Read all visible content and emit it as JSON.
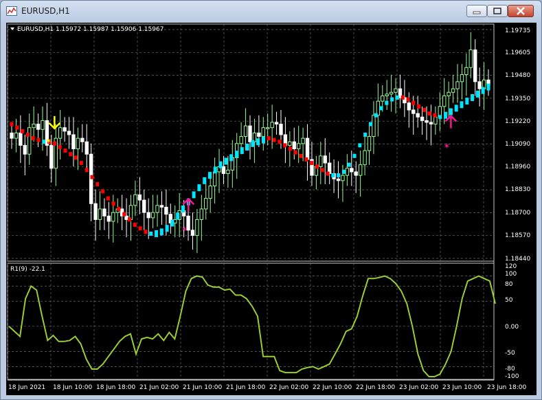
{
  "window": {
    "title": "EURUSD,H1"
  },
  "colors": {
    "background": "#000000",
    "grid": "#6e6e6e",
    "bull_candle": "#98fb98",
    "bear_candle": "#ffffff",
    "trend_down": "#ff0000",
    "trend_up": "#00e5ff",
    "sell_arrow": "#ffff00",
    "buy_arrow": "#ff1493",
    "oscillator": "#9acd32",
    "text": "#ffffff"
  },
  "icons": {
    "app": "chart-window-icon",
    "minimize": "minimize-icon",
    "maximize": "maximize-icon",
    "close": "close-icon",
    "menu": "triangle-down-icon"
  },
  "main_panel": {
    "header": "EURUSD,H1  1.15972 1.15987 1.15906 1.15967",
    "price_labels": [
      "1.19735",
      "1.19605",
      "1.19480",
      "1.19350",
      "1.19220",
      "1.19090",
      "1.18960",
      "1.18830",
      "1.18700",
      "1.18570",
      "1.18440"
    ]
  },
  "sub_panel": {
    "header": "R1(9) -22.1",
    "level_labels": [
      "120",
      "100",
      "80",
      "50",
      "0.00",
      "-50",
      "-80",
      "-100"
    ]
  },
  "time_labels": [
    "18 Jun 2021",
    "18 Jun 10:00",
    "18 Jun 18:00",
    "21 Jun 02:00",
    "21 Jun 10:00",
    "21 Jun 18:00",
    "22 Jun 02:00",
    "22 Jun 10:00",
    "22 Jun 18:00",
    "23 Jun 02:00",
    "23 Jun 10:00",
    "23 Jun 18:00"
  ],
  "chart_data": {
    "type": "line",
    "symbol": "EURUSD",
    "timeframe": "H1",
    "ohlc_last": {
      "open": 1.15972,
      "high": 1.15987,
      "low": 1.15906,
      "close": 1.15967
    },
    "price_axis": [
      1.1844,
      1.19735
    ],
    "close_series": [
      1.1912,
      1.1915,
      1.1908,
      1.1903,
      1.1918,
      1.192,
      1.1917,
      1.1922,
      1.1908,
      1.1895,
      1.1912,
      1.1918,
      1.1916,
      1.1914,
      1.1906,
      1.1912,
      1.191,
      1.1903,
      1.1875,
      1.1866,
      1.1872,
      1.1868,
      1.1865,
      1.187,
      1.1872,
      1.1868,
      1.1866,
      1.1874,
      1.188,
      1.1877,
      1.187,
      1.1867,
      1.187,
      1.1874,
      1.1873,
      1.1869,
      1.1864,
      1.1866,
      1.1871,
      1.1868,
      1.186,
      1.1857,
      1.1866,
      1.1872,
      1.1878,
      1.1885,
      1.1893,
      1.1896,
      1.1892,
      1.1894,
      1.1901,
      1.1909,
      1.1913,
      1.1919,
      1.191,
      1.1915,
      1.1913,
      1.1918,
      1.1918,
      1.1921,
      1.192,
      1.1914,
      1.1908,
      1.191,
      1.1906,
      1.1909,
      1.1912,
      1.19,
      1.1891,
      1.1896,
      1.1902,
      1.1898,
      1.1892,
      1.1889,
      1.1888,
      1.1891,
      1.1895,
      1.1893,
      1.1891,
      1.1897,
      1.1905,
      1.1913,
      1.1925,
      1.1933,
      1.1936,
      1.1937,
      1.1938,
      1.194,
      1.1935,
      1.1932,
      1.1928,
      1.1926,
      1.1924,
      1.1922,
      1.1921,
      1.192,
      1.1924,
      1.193,
      1.1936,
      1.1938,
      1.194,
      1.1944,
      1.1948,
      1.1952,
      1.1962,
      1.1944,
      1.194,
      1.1945,
      1.1942
    ],
    "trend_line": [
      1.192,
      1.1918,
      1.1916,
      1.1914,
      1.1912,
      1.1911,
      1.191,
      1.191,
      1.1909,
      1.1907,
      1.1905,
      1.1903,
      1.1901,
      1.1898,
      1.1894,
      1.189,
      1.1886,
      1.1882,
      1.1878,
      1.1875,
      1.1872,
      1.1869,
      1.1866,
      1.1863,
      1.1861,
      1.1859,
      1.1858,
      1.1858,
      1.1859,
      1.1861,
      1.1864,
      1.1868,
      1.1872,
      1.1876,
      1.188,
      1.1884,
      1.1888,
      1.1891,
      1.1894,
      1.1897,
      1.1899,
      1.1901,
      1.1903,
      1.1905,
      1.1907,
      1.1909,
      1.191,
      1.1911,
      1.1912,
      1.1911,
      1.191,
      1.1908,
      1.1906,
      1.1904,
      1.1902,
      1.19,
      1.1898,
      1.1896,
      1.1894,
      1.1892,
      1.1891,
      1.1891,
      1.1893,
      1.1897,
      1.1902,
      1.1908,
      1.1914,
      1.192,
      1.1925,
      1.1929,
      1.1932,
      1.1934,
      1.1935,
      1.1935,
      1.1934,
      1.1932,
      1.193,
      1.1928,
      1.1926,
      1.1925,
      1.1924,
      1.1925,
      1.1927,
      1.1929,
      1.1931,
      1.1933,
      1.1935,
      1.1937,
      1.1939,
      1.1941
    ],
    "signals": [
      {
        "type": "sell",
        "index": 10
      },
      {
        "type": "buy",
        "index": 41
      },
      {
        "type": "buy",
        "index": 100
      }
    ],
    "indicator": {
      "name": "R1(9)",
      "last": -22.1,
      "ylim": [
        -100,
        120
      ],
      "levels": [
        120,
        100,
        80,
        50,
        0,
        -50,
        -80,
        -100
      ],
      "values": [
        0,
        -10,
        -20,
        55,
        80,
        72,
        20,
        -28,
        -18,
        -30,
        -30,
        -28,
        -20,
        -35,
        -65,
        -85,
        -85,
        -75,
        -60,
        -45,
        -30,
        -20,
        -15,
        -55,
        -25,
        -22,
        -25,
        -15,
        -28,
        -12,
        -25,
        20,
        70,
        95,
        100,
        98,
        82,
        78,
        78,
        72,
        74,
        62,
        62,
        55,
        40,
        20,
        -60,
        -60,
        -60,
        -88,
        -92,
        -92,
        -92,
        -85,
        -82,
        -80,
        -85,
        -80,
        -75,
        -55,
        -35,
        -10,
        -5,
        20,
        60,
        95,
        95,
        97,
        100,
        95,
        85,
        70,
        45,
        0,
        -55,
        -88,
        -105,
        -105,
        -95,
        -75,
        -50,
        0,
        55,
        90,
        95,
        100,
        95,
        90,
        45
      ]
    }
  }
}
